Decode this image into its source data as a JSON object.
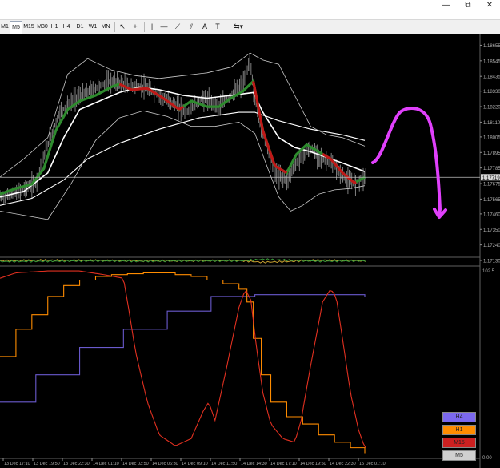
{
  "window_buttons": [
    {
      "name": "minimize",
      "glyph": "—"
    },
    {
      "name": "restore",
      "glyph": "⧉"
    },
    {
      "name": "close",
      "glyph": "✕"
    }
  ],
  "toolbar": {
    "timeframes": [
      "M1",
      "M5",
      "M15",
      "M30",
      "H1",
      "H4",
      "D1",
      "W1",
      "MN"
    ],
    "active_timeframe": "M5",
    "tools": [
      {
        "name": "cursor-icon",
        "glyph": "↖"
      },
      {
        "name": "crosshair-icon",
        "glyph": "+"
      },
      {
        "name": "vertical-line-icon",
        "glyph": "|"
      },
      {
        "name": "horizontal-line-icon",
        "glyph": "—"
      },
      {
        "name": "trendline-icon",
        "glyph": "⟋"
      },
      {
        "name": "channel-icon",
        "glyph": "⫽"
      },
      {
        "name": "text-icon",
        "glyph": "A"
      },
      {
        "name": "label-icon",
        "glyph": "T"
      },
      {
        "name": "shapes-icon",
        "glyph": "⇆▾"
      }
    ]
  },
  "chart_data": [
    {
      "type": "line",
      "panel": "price",
      "price_ticks": [
        "1.18655",
        "1.18545",
        "1.18435",
        "1.18330",
        "1.18220",
        "1.18110",
        "1.18005",
        "1.17895",
        "1.17785",
        "1.17675",
        "1.17565",
        "1.17460",
        "1.17350",
        "1.17240",
        "1.17130"
      ],
      "price_label": "1.17719",
      "crosshair_price": 1.17719,
      "ylim": [
        1.1713,
        1.1872
      ],
      "x_points": 460,
      "series": [
        {
          "name": "",
          "color": "#808080",
          "style": "bar-cloud",
          "points": [
            [
              0,
              1.1758
            ],
            [
              25,
              1.1762
            ],
            [
              45,
              1.1768
            ],
            [
              60,
              1.1795
            ],
            [
              75,
              1.1818
            ],
            [
              95,
              1.1828
            ],
            [
              120,
              1.1835
            ],
            [
              140,
              1.184
            ],
            [
              160,
              1.1837
            ],
            [
              180,
              1.1836
            ],
            [
              200,
              1.183
            ],
            [
              215,
              1.1825
            ],
            [
              235,
              1.1818
            ],
            [
              255,
              1.1828
            ],
            [
              275,
              1.1822
            ],
            [
              290,
              1.183
            ],
            [
              305,
              1.1838
            ],
            [
              314,
              1.1855
            ],
            [
              318,
              1.1835
            ],
            [
              325,
              1.1812
            ],
            [
              335,
              1.1795
            ],
            [
              345,
              1.1775
            ],
            [
              360,
              1.177
            ],
            [
              375,
              1.1785
            ],
            [
              390,
              1.1792
            ],
            [
              405,
              1.1785
            ],
            [
              420,
              1.178
            ],
            [
              435,
              1.177
            ],
            [
              445,
              1.1768
            ],
            [
              458,
              1.1772
            ]
          ]
        },
        {
          "name": "",
          "color": "#2e8b2e",
          "style": "thick-trend",
          "points": [
            [
              0,
              1.176
            ],
            [
              20,
              1.1764
            ],
            [
              40,
              1.1767
            ],
            [
              55,
              1.1778
            ],
            [
              70,
              1.1805
            ],
            [
              85,
              1.182
            ],
            [
              100,
              1.1826
            ],
            [
              120,
              1.183
            ],
            [
              140,
              1.1836
            ],
            [
              150,
              1.1838
            ],
            [
              165,
              1.1834
            ],
            [
              185,
              1.1835
            ],
            [
              205,
              1.1828
            ],
            [
              225,
              1.182
            ],
            [
              240,
              1.1826
            ],
            [
              260,
              1.1822
            ],
            [
              275,
              1.1822
            ],
            [
              290,
              1.1828
            ],
            [
              305,
              1.1833
            ],
            [
              318,
              1.184
            ],
            [
              330,
              1.1805
            ],
            [
              345,
              1.178
            ],
            [
              360,
              1.1775
            ],
            [
              372,
              1.1788
            ],
            [
              385,
              1.1795
            ],
            [
              400,
              1.179
            ],
            [
              415,
              1.1785
            ],
            [
              430,
              1.1775
            ],
            [
              445,
              1.1768
            ],
            [
              458,
              1.1772
            ]
          ],
          "red_ranges": [
            [
              150,
              230
            ],
            [
              318,
              360
            ],
            [
              405,
              448
            ]
          ]
        },
        {
          "name": "",
          "color": "#ffffff",
          "style": "ma-fast",
          "points": [
            [
              0,
              1.1758
            ],
            [
              30,
              1.1762
            ],
            [
              60,
              1.1775
            ],
            [
              80,
              1.18
            ],
            [
              100,
              1.182
            ],
            [
              125,
              1.1826
            ],
            [
              150,
              1.1832
            ],
            [
              175,
              1.1836
            ],
            [
              200,
              1.1834
            ],
            [
              230,
              1.183
            ],
            [
              260,
              1.1828
            ],
            [
              290,
              1.183
            ],
            [
              318,
              1.1832
            ],
            [
              330,
              1.1818
            ],
            [
              350,
              1.18
            ],
            [
              370,
              1.1793
            ],
            [
              390,
              1.179
            ],
            [
              410,
              1.1786
            ],
            [
              430,
              1.1782
            ],
            [
              458,
              1.1776
            ]
          ]
        },
        {
          "name": "",
          "color": "#ffffff",
          "style": "ma-slow",
          "points": [
            [
              0,
              1.1752
            ],
            [
              40,
              1.1757
            ],
            [
              80,
              1.177
            ],
            [
              110,
              1.1785
            ],
            [
              150,
              1.1796
            ],
            [
              200,
              1.1806
            ],
            [
              250,
              1.1814
            ],
            [
              300,
              1.1818
            ],
            [
              320,
              1.1818
            ],
            [
              350,
              1.1812
            ],
            [
              390,
              1.1806
            ],
            [
              430,
              1.1802
            ],
            [
              458,
              1.1798
            ]
          ]
        },
        {
          "name": "",
          "color": "#c8c8c8",
          "style": "band-upper",
          "points": [
            [
              0,
              1.1772
            ],
            [
              30,
              1.1785
            ],
            [
              60,
              1.18
            ],
            [
              85,
              1.1845
            ],
            [
              110,
              1.1856
            ],
            [
              140,
              1.1848
            ],
            [
              170,
              1.1844
            ],
            [
              200,
              1.1842
            ],
            [
              230,
              1.1844
            ],
            [
              260,
              1.1846
            ],
            [
              290,
              1.185
            ],
            [
              314,
              1.186
            ],
            [
              330,
              1.1855
            ],
            [
              350,
              1.1852
            ],
            [
              370,
              1.183
            ],
            [
              390,
              1.1808
            ],
            [
              410,
              1.1802
            ],
            [
              430,
              1.18
            ],
            [
              458,
              1.1794
            ]
          ]
        },
        {
          "name": "",
          "color": "#c8c8c8",
          "style": "band-lower",
          "points": [
            [
              0,
              1.1748
            ],
            [
              30,
              1.1745
            ],
            [
              60,
              1.1742
            ],
            [
              90,
              1.1768
            ],
            [
              120,
              1.1798
            ],
            [
              150,
              1.1814
            ],
            [
              180,
              1.1819
            ],
            [
              210,
              1.1815
            ],
            [
              240,
              1.1808
            ],
            [
              270,
              1.1808
            ],
            [
              300,
              1.1811
            ],
            [
              320,
              1.1803
            ],
            [
              335,
              1.178
            ],
            [
              350,
              1.1758
            ],
            [
              365,
              1.1748
            ],
            [
              380,
              1.1752
            ],
            [
              400,
              1.176
            ],
            [
              420,
              1.1763
            ],
            [
              440,
              1.1764
            ],
            [
              458,
              1.1766
            ]
          ]
        }
      ]
    },
    {
      "type": "line",
      "panel": "momentum-strip",
      "series": [
        {
          "name": "",
          "color": "#c8a030",
          "points": [
            [
              0,
              0.5
            ],
            [
              60,
              0.6
            ],
            [
              120,
              0.55
            ],
            [
              180,
              0.5
            ],
            [
              240,
              0.5
            ],
            [
              300,
              0.55
            ],
            [
              330,
              0.3
            ],
            [
              360,
              0.4
            ],
            [
              400,
              0.6
            ],
            [
              458,
              0.5
            ]
          ]
        },
        {
          "name": "",
          "color": "#3a9a3a",
          "points": [
            [
              0,
              0.4
            ],
            [
              60,
              0.45
            ],
            [
              120,
              0.5
            ],
            [
              180,
              0.45
            ],
            [
              240,
              0.5
            ],
            [
              300,
              0.5
            ],
            [
              330,
              0.7
            ],
            [
              360,
              0.6
            ],
            [
              400,
              0.45
            ],
            [
              458,
              0.5
            ]
          ]
        }
      ]
    },
    {
      "type": "line",
      "panel": "indicator",
      "ylim": [
        0,
        102.5
      ],
      "y_ticks": [
        "102.5",
        "0.00"
      ],
      "x_labels": [
        "13 Dec 17:10",
        "13 Dec 19:50",
        "13 Dec 22:30",
        "14 Dec 01:10",
        "14 Dec 03:50",
        "14 Dec 06:30",
        "14 Dec 09:10",
        "14 Dec 11:50",
        "14 Dec 14:30",
        "14 Dec 17:10",
        "14 Dec 19:50",
        "14 Dec 22:30",
        "15 Dec 01:10"
      ],
      "legend": [
        {
          "label": "H4",
          "bg": "#7b68ee",
          "fg": "#222222"
        },
        {
          "label": "H1",
          "bg": "#ff8c00",
          "fg": "#222222"
        },
        {
          "label": "M15",
          "bg": "#cc2020",
          "fg": "#222222"
        },
        {
          "label": "M5",
          "bg": "#d0d0d0",
          "fg": "#222222"
        }
      ],
      "series": [
        {
          "name": "H4",
          "color": "#6a5acd",
          "step": true,
          "points": [
            [
              0,
              30
            ],
            [
              45,
              30
            ],
            [
              45,
              45
            ],
            [
              100,
              45
            ],
            [
              100,
              60
            ],
            [
              155,
              60
            ],
            [
              155,
              70
            ],
            [
              210,
              70
            ],
            [
              210,
              80
            ],
            [
              265,
              80
            ],
            [
              265,
              88
            ],
            [
              320,
              88
            ],
            [
              320,
              89
            ],
            [
              458,
              88
            ]
          ]
        },
        {
          "name": "H1",
          "color": "#ff8c00",
          "step": true,
          "points": [
            [
              0,
              55
            ],
            [
              20,
              70
            ],
            [
              40,
              78
            ],
            [
              60,
              88
            ],
            [
              80,
              94
            ],
            [
              100,
              97
            ],
            [
              120,
              99
            ],
            [
              140,
              100
            ],
            [
              160,
              100.5
            ],
            [
              180,
              101
            ],
            [
              200,
              101
            ],
            [
              220,
              100
            ],
            [
              240,
              99
            ],
            [
              260,
              97
            ],
            [
              280,
              95
            ],
            [
              300,
              92
            ],
            [
              310,
              85
            ],
            [
              318,
              65
            ],
            [
              328,
              45
            ],
            [
              340,
              30
            ],
            [
              360,
              22
            ],
            [
              380,
              18
            ],
            [
              400,
              12
            ],
            [
              420,
              8
            ],
            [
              440,
              5
            ],
            [
              458,
              2
            ]
          ]
        },
        {
          "name": "M15",
          "color": "#e03020",
          "step": false,
          "points": [
            [
              0,
              98
            ],
            [
              20,
              101
            ],
            [
              60,
              102
            ],
            [
              100,
              102
            ],
            [
              130,
              100
            ],
            [
              155,
              98
            ],
            [
              162,
              80
            ],
            [
              170,
              58
            ],
            [
              185,
              30
            ],
            [
              200,
              12
            ],
            [
              220,
              6
            ],
            [
              240,
              10
            ],
            [
              255,
              25
            ],
            [
              262,
              30
            ],
            [
              270,
              20
            ],
            [
              285,
              50
            ],
            [
              300,
              82
            ],
            [
              308,
              92
            ],
            [
              315,
              86
            ],
            [
              322,
              60
            ],
            [
              330,
              35
            ],
            [
              340,
              18
            ],
            [
              355,
              10
            ],
            [
              370,
              8
            ],
            [
              378,
              20
            ],
            [
              390,
              50
            ],
            [
              405,
              85
            ],
            [
              415,
              92
            ],
            [
              422,
              88
            ],
            [
              430,
              65
            ],
            [
              440,
              35
            ],
            [
              450,
              15
            ],
            [
              458,
              5
            ]
          ]
        }
      ]
    }
  ]
}
